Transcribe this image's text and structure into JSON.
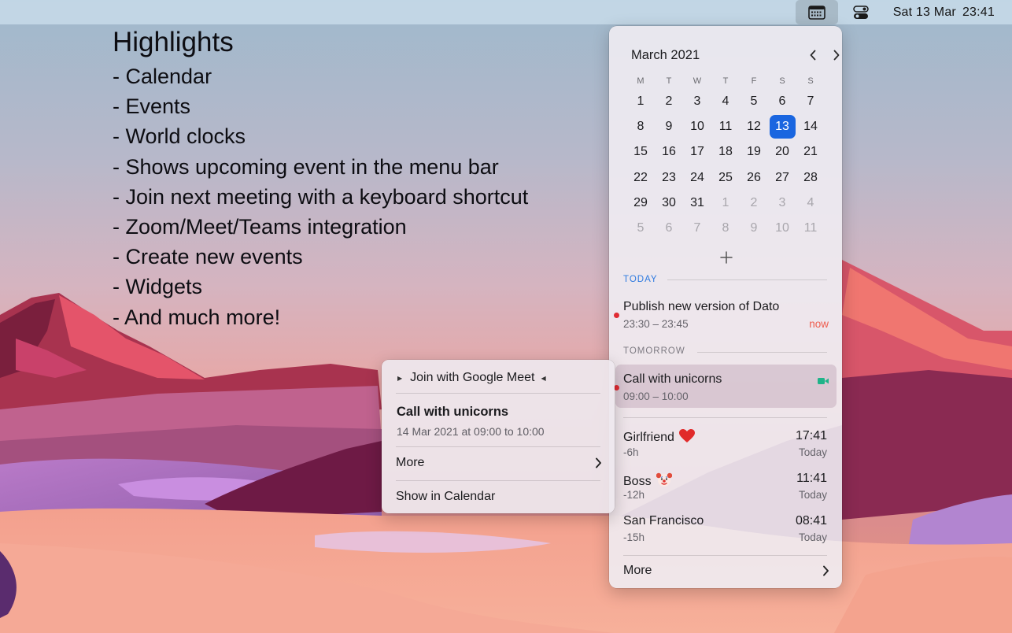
{
  "menubar": {
    "calendar_icon": "calendar-grid-icon",
    "control_center_icon": "control-center-icon",
    "date": "Sat 13 Mar",
    "time": "23:41"
  },
  "highlights": {
    "title": "Highlights",
    "items": [
      "- Calendar",
      "- Events",
      "- World clocks",
      "- Shows upcoming event in the menu bar",
      "- Join next meeting with a keyboard shortcut",
      "- Zoom/Meet/Teams integration",
      "- Create new events",
      "- Widgets",
      "- And much more!"
    ]
  },
  "calendar": {
    "month_title": "March 2021",
    "prev_icon": "chevron-left-icon",
    "next_icon": "chevron-right-icon",
    "weekdays": [
      "M",
      "T",
      "W",
      "T",
      "F",
      "S",
      "S"
    ],
    "weeks": [
      [
        "1",
        "2",
        "3",
        "4",
        "5",
        "6",
        "7"
      ],
      [
        "8",
        "9",
        "10",
        "11",
        "12",
        "13",
        "14"
      ],
      [
        "15",
        "16",
        "17",
        "18",
        "19",
        "20",
        "21"
      ],
      [
        "22",
        "23",
        "24",
        "25",
        "26",
        "27",
        "28"
      ],
      [
        "29",
        "30",
        "31",
        "1",
        "2",
        "3",
        "4"
      ],
      [
        "5",
        "6",
        "7",
        "8",
        "9",
        "10",
        "11"
      ]
    ],
    "selected_day": "13",
    "add_icon": "plus-icon",
    "accent_color": "#1a66e0"
  },
  "sections": {
    "today": "TODAY",
    "tomorrow": "TOMORROW"
  },
  "events": [
    {
      "title": "Publish new version of Dato",
      "time": "23:30 – 23:45",
      "badge": "now",
      "dot_color": "#e02b33"
    },
    {
      "title": "Call with unicorns",
      "time": "09:00 – 10:00",
      "icon": "video-camera-icon",
      "dot_color": "#e02b33"
    }
  ],
  "world_clocks": [
    {
      "name": "Girlfriend",
      "emoji_icon": "red-heart-icon",
      "offset": "-6h",
      "time": "17:41",
      "day": "Today"
    },
    {
      "name": "Boss",
      "emoji_icon": "clown-face-icon",
      "offset": "-12h",
      "time": "11:41",
      "day": "Today"
    },
    {
      "name": "San Francisco",
      "offset": "-15h",
      "time": "08:41",
      "day": "Today"
    }
  ],
  "panel_more": "More",
  "context_menu": {
    "join_label": "Join with Google Meet",
    "event_title": "Call with unicorns",
    "event_time": "14 Mar 2021 at 09:00 to 10:00",
    "more_label": "More",
    "show_label": "Show in Calendar"
  }
}
